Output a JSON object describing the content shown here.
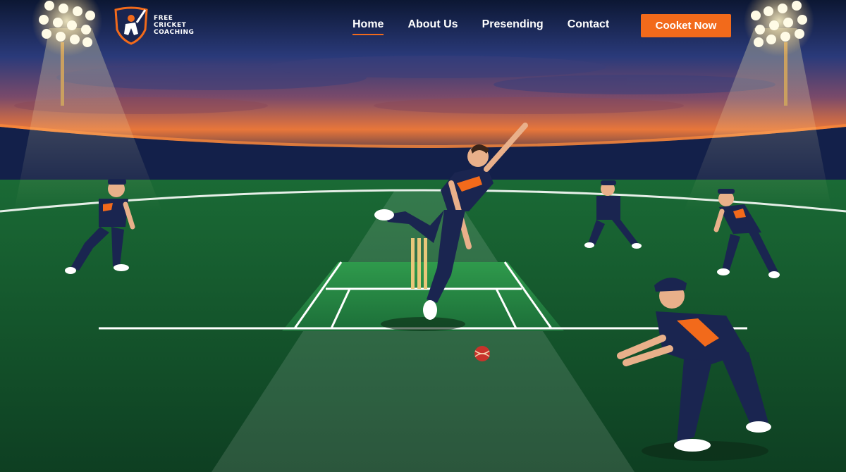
{
  "brand": {
    "line1": "FREE",
    "line2": "CRICKET",
    "line3": "COACHING"
  },
  "nav": {
    "items": [
      {
        "label": "Home",
        "active": true
      },
      {
        "label": "About Us",
        "active": false
      },
      {
        "label": "Presending",
        "active": false
      },
      {
        "label": "Contact",
        "active": false
      }
    ],
    "cta_label": "Cooket Now"
  },
  "colors": {
    "accent": "#f26a1b",
    "navy": "#1a2550",
    "pitch_green": "#1f7a3a",
    "sky_top": "#0f1b3a",
    "sunset": "#e8763a"
  },
  "icons": {
    "logo": "batsman-shield-icon",
    "floodlight": "floodlight-icon",
    "ball": "cricket-ball-icon",
    "stumps": "stumps-icon"
  }
}
